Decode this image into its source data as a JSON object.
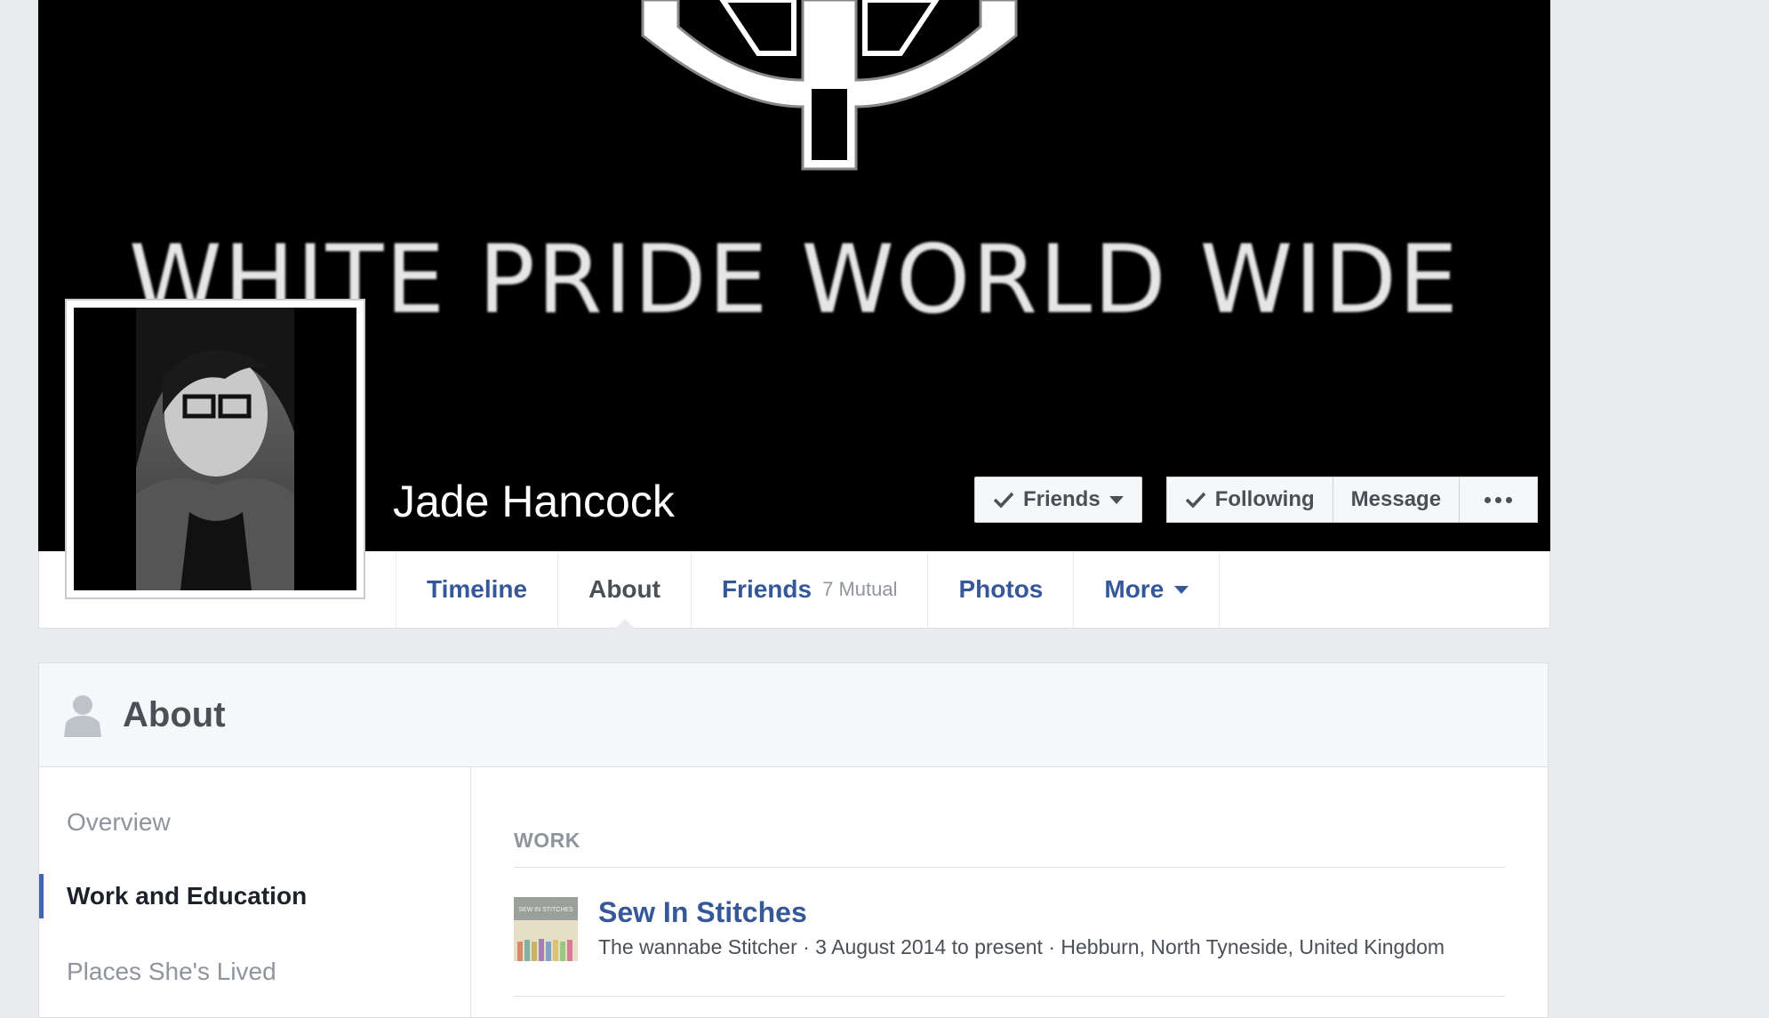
{
  "cover": {
    "text": "WHITE PRIDE WORLD WIDE"
  },
  "profile": {
    "name": "Jade Hancock"
  },
  "actions": {
    "friends": "Friends",
    "following": "Following",
    "message": "Message"
  },
  "nav": {
    "tabs": [
      {
        "label": "Timeline"
      },
      {
        "label": "About"
      },
      {
        "label": "Friends",
        "sub": "7 Mutual"
      },
      {
        "label": "Photos"
      },
      {
        "label": "More"
      }
    ]
  },
  "about": {
    "title": "About",
    "sidebar": [
      {
        "label": "Overview"
      },
      {
        "label": "Work and Education"
      },
      {
        "label": "Places She's Lived"
      }
    ],
    "section_label": "WORK",
    "work": {
      "title": "Sew In Stitches",
      "thumb_text": "SEW IN STITCHES",
      "subtitle": "The wannabe Stitcher · 3 August 2014 to present · Hebburn, North Tyneside, United Kingdom"
    }
  },
  "colors": {
    "link": "#365899",
    "accent": "#4267b2",
    "background": "#e9ebee"
  }
}
